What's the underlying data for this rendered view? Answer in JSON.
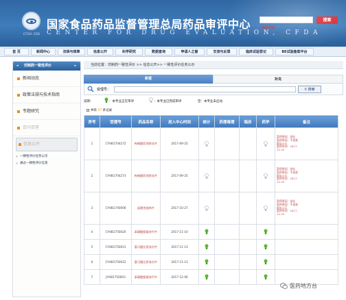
{
  "header": {
    "title_cn": "国家食品药品监督管理总局药品审评中心",
    "title_en": "CENTER FOR DRUG EVALUATION, CFDA",
    "logo_abbr": "CFDA CDE",
    "search_button": "搜索",
    "advanced_search": "高级搜索"
  },
  "nav": {
    "items": [
      {
        "label": "首 页"
      },
      {
        "label": "新闻中心"
      },
      {
        "label": "法规与规章"
      },
      {
        "label": "信息公开"
      },
      {
        "label": "科学研究"
      },
      {
        "label": "数据查询"
      },
      {
        "label": "申请人之窗"
      },
      {
        "label": "交流与反馈"
      },
      {
        "label": "临床试验登记"
      },
      {
        "label": "BE试验备案平台"
      }
    ]
  },
  "sidebar": {
    "head": "仿制药一致性评价",
    "sections": [
      {
        "label": "新闻动态"
      },
      {
        "label": "政策法规与技术指南"
      },
      {
        "label": "专题研究"
      },
      {
        "label": "百问百答"
      }
    ],
    "active_section": "信息公开",
    "sub_items": [
      {
        "label": "一致性评价任务公示"
      },
      {
        "label": "通过一致性评价信息"
      }
    ]
  },
  "main": {
    "breadcrumb": "当前位置：仿制药一致性评价 >> 信息公开>> 一致性评价任务公示",
    "tabs": [
      {
        "label": "新报"
      },
      {
        "label": "补充"
      }
    ],
    "search_label": "受理号：",
    "search_value": "",
    "search_button": "搜索",
    "legend": {
      "prefix": "说明：",
      "in_progress": "：本专业正在审评",
      "done": "：本专业已完成审评",
      "not_started": "空：本专业未启动"
    },
    "count_prefix": "共有",
    "count": "27",
    "count_suffix": "条记录",
    "table": {
      "headers": [
        "序号",
        "受理号",
        "药品名称",
        "进入中心时间",
        "统计",
        "药理毒理",
        "临床",
        "药学",
        "备注"
      ],
      "rows": [
        {
          "no": "1",
          "code": "CYHB1704272",
          "name": "枸橼酸西地那非片",
          "date": "2017-09-25",
          "stat": "done",
          "pharm": "",
          "clinical": "",
          "chem": "done",
          "remark": [
            "暂停原因：部长",
            "暂停原因：不批准",
            "报告公示",
            "暂停时间：2017-",
            "12-25"
          ]
        },
        {
          "no": "2",
          "code": "CYHB1704273",
          "name": "枸橼酸西地那非片",
          "date": "2017-09-25",
          "stat": "done",
          "pharm": "",
          "clinical": "",
          "chem": "done",
          "remark": [
            "暂停原因：部长",
            "暂停原因：不批准",
            "报告公示",
            "暂停时间：2017-",
            "12-25"
          ]
        },
        {
          "no": "3",
          "code": "CYHB1740006",
          "name": "盐酸舍曲林片",
          "date": "2017-10-27",
          "stat": "done",
          "pharm": "",
          "clinical": "",
          "chem": "done",
          "remark": [
            "暂停原因：部长",
            "暂停原因：不批准",
            "报告公示",
            "暂停时间：2017-",
            "12-25"
          ]
        },
        {
          "no": "4",
          "code": "CYHB1750020",
          "name": "苯磺酸氨氯地平片",
          "date": "2017-11-10",
          "stat": "progress",
          "pharm": "",
          "clinical": "",
          "chem": "progress",
          "remark": []
        },
        {
          "no": "5",
          "code": "CYHB1750021",
          "name": "富马酸比索洛尔片",
          "date": "2017-11-13",
          "stat": "progress",
          "pharm": "",
          "clinical": "",
          "chem": "progress",
          "remark": []
        },
        {
          "no": "6",
          "code": "CYHB1750022",
          "name": "富马酸比索洛尔片",
          "date": "2017-11-13",
          "stat": "progress",
          "pharm": "",
          "clinical": "",
          "chem": "progress",
          "remark": []
        },
        {
          "no": "7",
          "code": "JYHB1750003",
          "name": "苯磺酸氨氯地平片",
          "date": "2017-12-06",
          "stat": "progress",
          "pharm": "",
          "clinical": "",
          "chem": "progress",
          "remark": []
        }
      ]
    }
  },
  "watermark": "医药地方台",
  "colors": {
    "header_blue": "#3f7cbb",
    "nav_bg": "#e9eff6",
    "search_red": "#d9232b",
    "bulb_in_progress": "#5bb832",
    "bulb_done": "#cdd3d8",
    "orange_marker": "#f08a1c",
    "link_red": "#c24b4b"
  }
}
